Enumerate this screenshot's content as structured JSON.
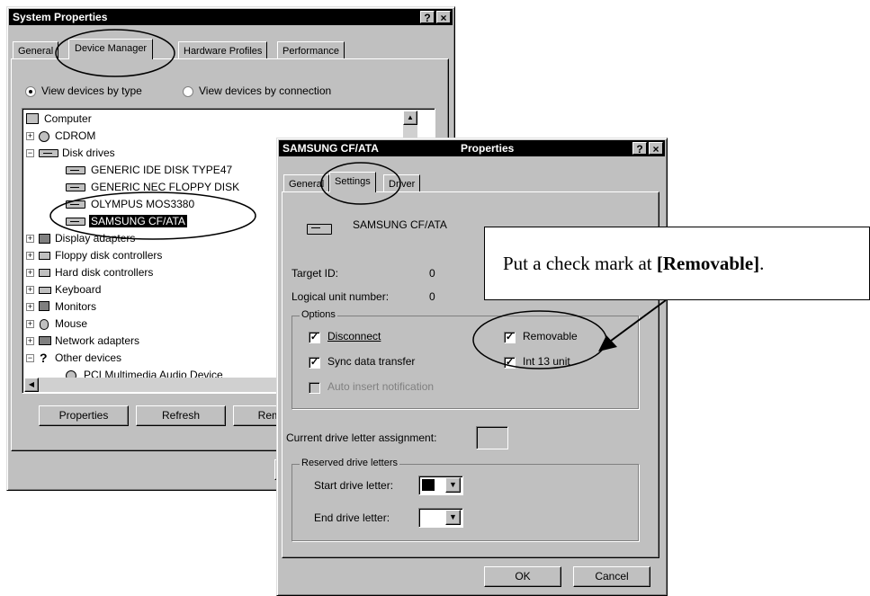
{
  "sysprops": {
    "title": "System Properties",
    "help_btn": "?",
    "close_btn": "×",
    "tabs": [
      "General",
      "Device Manager",
      "Hardware Profiles",
      "Performance"
    ],
    "view_by_type": "View devices by type",
    "view_by_connection": "View devices by connection",
    "tree": {
      "computer": "Computer",
      "cdrom": "CDROM",
      "disk_drives": "Disk drives",
      "disks": [
        "GENERIC IDE  DISK TYPE47",
        "GENERIC NEC  FLOPPY DISK",
        "OLYMPUS MOS3380",
        "SAMSUNG CF/ATA"
      ],
      "others": [
        "Display adapters",
        "Floppy disk controllers",
        "Hard disk controllers",
        "Keyboard",
        "Monitors",
        "Mouse",
        "Network adapters",
        "Other devices",
        "PCI Multimedia Audio Device"
      ]
    },
    "buttons": {
      "properties": "Properties",
      "refresh": "Refresh",
      "remove": "Remove"
    },
    "plus": "+",
    "minus": "−"
  },
  "props": {
    "title_left": "SAMSUNG CF/ATA",
    "title_right": "Properties",
    "help_btn": "?",
    "close_btn": "×",
    "tabs": [
      "General",
      "Settings",
      "Driver"
    ],
    "device_name": "SAMSUNG CF/ATA",
    "target_id_label": "Target ID:",
    "target_id_value": "0",
    "lun_label": "Logical unit number:",
    "lun_value": "0",
    "options_label": "Options",
    "disconnect": "Disconnect",
    "removable": "Removable",
    "sync": "Sync data transfer",
    "int13": "Int 13 unit",
    "auto_insert": "Auto insert notification",
    "check": "✓",
    "current_letter_label": "Current drive letter assignment:",
    "reserved_label": "Reserved drive letters",
    "start_letter": "Start drive letter:",
    "end_letter": "End drive letter:",
    "ok": "OK",
    "cancel": "Cancel",
    "dropdown_arrow": "▼"
  },
  "callout": {
    "text_prefix": "Put a check mark at ",
    "text_bold": "[Removable]",
    "text_suffix": "."
  }
}
